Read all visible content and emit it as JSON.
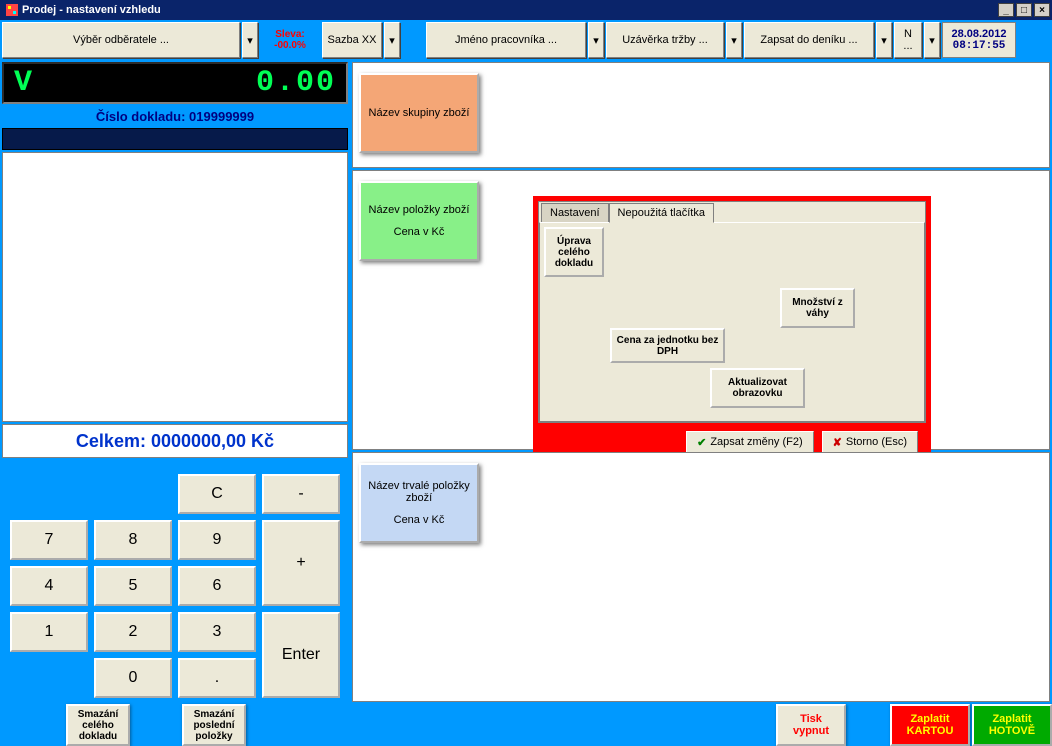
{
  "window": {
    "title": "Prodej - nastavení vzhledu"
  },
  "top": {
    "customer": "Výběr odběratele ...",
    "discount_label": "Sleva:",
    "discount_value": "-00.0%",
    "rate": "Sazba XX",
    "employee": "Jméno pracovníka ...",
    "closing": "Uzávěrka tržby ...",
    "journal": "Zapsat do deníku ...",
    "n": "N ...",
    "date": "28.08.2012",
    "time": "08:17:55"
  },
  "display": {
    "symbol": "V",
    "value": "0.00"
  },
  "doc_num": "Číslo dokladu: 019999999",
  "total": "Celkem: 0000000,00 Kč",
  "keypad": {
    "c": "C",
    "minus": "-",
    "plus": "+",
    "enter": "Enter",
    "k0": "0",
    "k1": "1",
    "k2": "2",
    "k3": "3",
    "k4": "4",
    "k5": "5",
    "k6": "6",
    "k7": "7",
    "k8": "8",
    "k9": "9",
    "dot": "."
  },
  "bottom_small": {
    "del_all": "Smazání celého dokladu",
    "del_last": "Smazání poslední položky"
  },
  "tiles": {
    "group": "Název skupiny zboží",
    "item_name": "Název položky zboží",
    "item_price": "Cena v Kč",
    "perm_name": "Název trvalé položky zboží",
    "perm_price": "Cena v Kč"
  },
  "dialog": {
    "tab_settings": "Nastavení",
    "tab_unused": "Nepoužitá tlačítka",
    "btn_edit_doc": "Úprava celého dokladu",
    "btn_qty_weight": "Množství z váhy",
    "btn_unit_price": "Cena za jednotku bez DPH",
    "btn_refresh": "Aktualizovat obrazovku",
    "save": "Zapsat změny (F2)",
    "cancel": "Storno (Esc)"
  },
  "footer": {
    "print_off": "Tisk vypnut",
    "pay_card": "Zaplatit KARTOU",
    "pay_cash": "Zaplatit HOTOVĚ"
  }
}
